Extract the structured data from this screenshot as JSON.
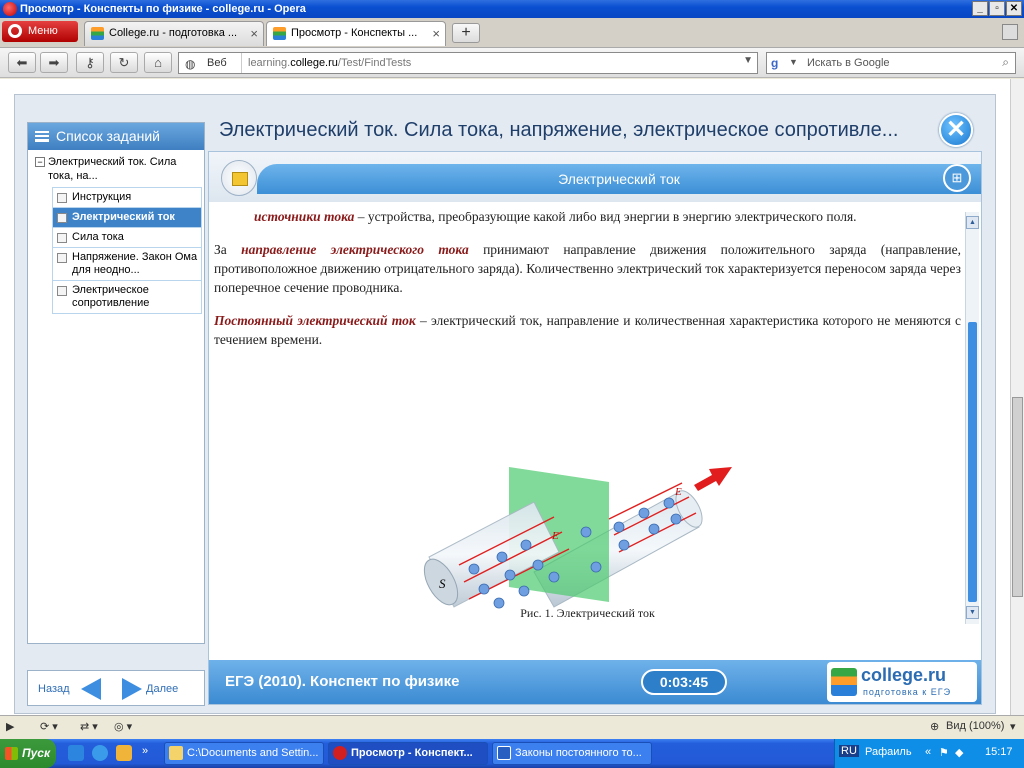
{
  "window": {
    "title": "Просмотр - Конспекты по физике - college.ru - Opera",
    "controls": [
      "_",
      "▫",
      "✕"
    ]
  },
  "tabs": {
    "menu_label": "Меню",
    "items": [
      {
        "label": "College.ru - подготовка ..."
      },
      {
        "label": "Просмотр - Конспекты ..."
      }
    ],
    "new_tab": "+"
  },
  "address": {
    "web_label": "Веб",
    "url_prefix": "learning.",
    "url_domain": "college.ru",
    "url_path": "/Test/FindTests",
    "search_placeholder": "Искать в Google"
  },
  "sidebar": {
    "title": "Список заданий",
    "root": {
      "label": "Электрический ток. Сила тока, на...",
      "toggle": "−"
    },
    "items": [
      {
        "label": "Инструкция",
        "active": false
      },
      {
        "label": "Электрический ток",
        "active": true
      },
      {
        "label": "Сила тока",
        "active": false
      },
      {
        "label": "Напряжение. Закон Ома для неодно...",
        "active": false
      },
      {
        "label": "Электрическое сопротивление",
        "active": false
      }
    ],
    "back_label": "Назад",
    "next_label": "Далее"
  },
  "main": {
    "title": "Электрический ток. Сила тока, напряжение, электрическое сопротивле...",
    "close": "✕",
    "section_title": "Электрический ток",
    "p1_term": "источники тока",
    "p1_rest": " – устройства, преобразующие какой либо вид энергии в энергию электрического поля.",
    "p2_lead": "За ",
    "p2_term": "направление электрического тока",
    "p2_rest": " принимают направление движения положительного заряда (направление, противоположное движению отрицательного заряда). Количественно электрический ток характеризуется переносом заряда через поперечное сечение проводника.",
    "p3_term": "Постоянный электрический ток",
    "p3_rest": " – электрический ток, направление и количественная характеристика которого не меняются с течением времени.",
    "figure_s": "S",
    "figure_e1": "E",
    "figure_e2": "E",
    "caption": "Рис. 1. Электрический ток"
  },
  "footer": {
    "course": "ЕГЭ (2010). Конспект по физике",
    "timer": "0:03:45",
    "logo_name": "college.ru",
    "logo_tag": "подготовка к ЕГЭ"
  },
  "statusbar": {
    "zoom": "Вид (100%)"
  },
  "taskbar": {
    "start": "Пуск",
    "tasks": [
      {
        "label": "C:\\Documents and Settin...",
        "active": false
      },
      {
        "label": "Просмотр - Конспект...",
        "active": true
      },
      {
        "label": "Законы постоянного то...",
        "active": false
      }
    ],
    "lang": "RU",
    "user": "Рафаиль",
    "clock": "15:17"
  },
  "colors": {
    "accent": "#3e83c8",
    "term": "#8a1a1a",
    "band": "#3c8fd6"
  }
}
